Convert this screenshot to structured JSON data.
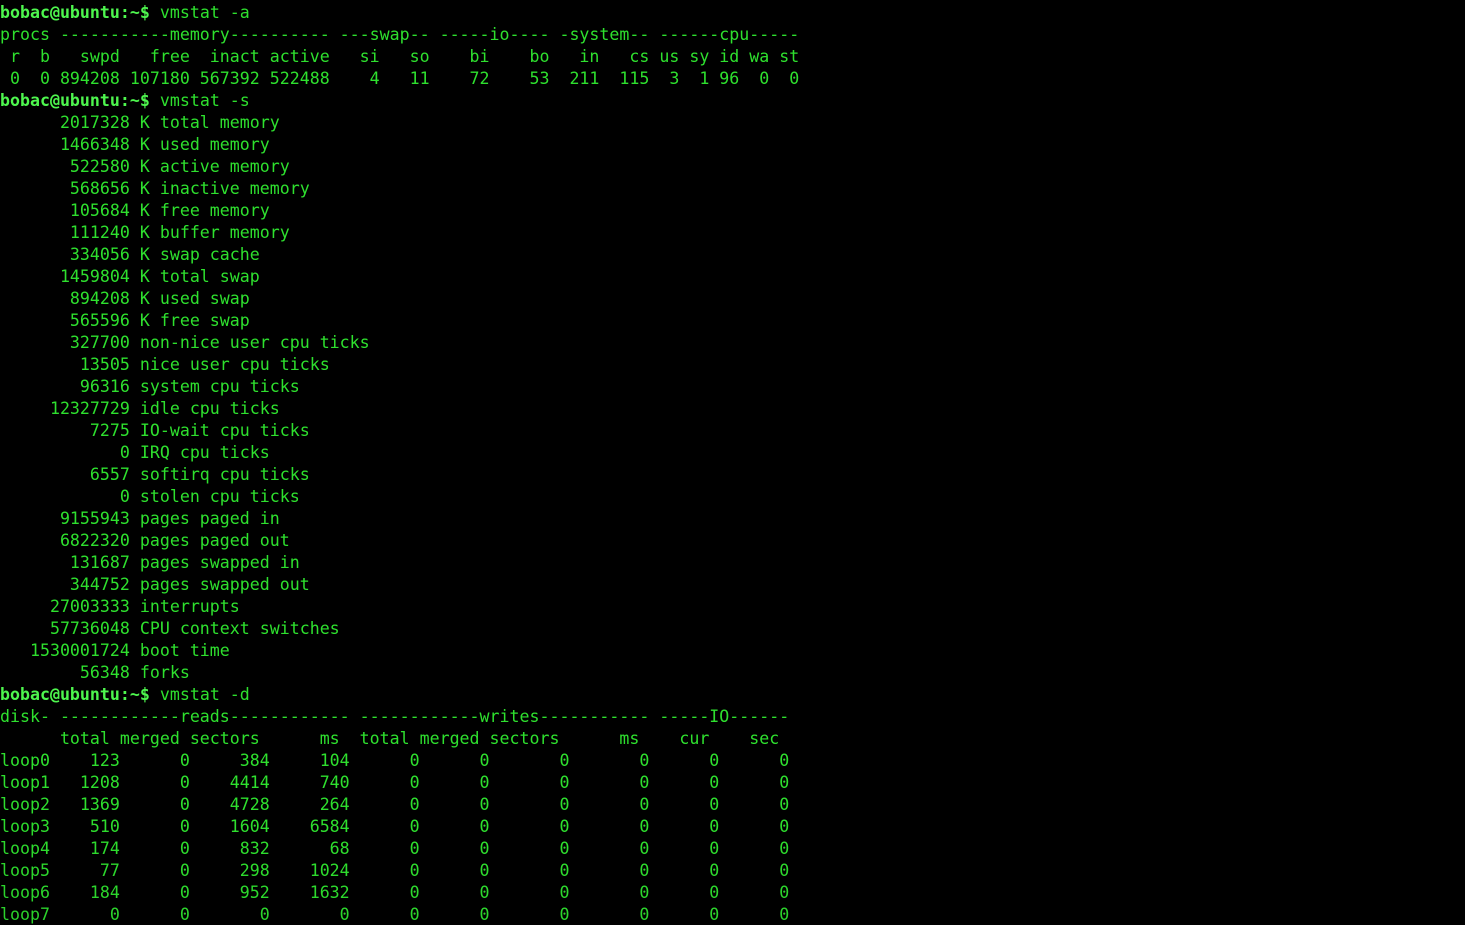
{
  "terminal": {
    "title": "bobac@ubuntu: ~",
    "prompt_user": "bobac@ubuntu",
    "prompt_path": ":~$",
    "colors": {
      "background": "#000000",
      "foreground": "#2ee02e",
      "prompt": "#4ef64e"
    }
  },
  "session": {
    "commands": [
      {
        "prompt_user": "bobac@ubuntu",
        "prompt_path": ":~$",
        "command": " vmstat -a"
      },
      {
        "prompt_user": "bobac@ubuntu",
        "prompt_path": ":~$",
        "command": " vmstat -s"
      },
      {
        "prompt_user": "bobac@ubuntu",
        "prompt_path": ":~$",
        "command": " vmstat -d"
      }
    ]
  },
  "vmstat_a": {
    "group_header": "procs -----------memory---------- ---swap-- -----io---- -system-- ------cpu-----",
    "column_header": " r  b   swpd   free  inact active   si   so    bi    bo   in   cs us sy id wa st",
    "data_row": " 0  0 894208 107180 567392 522488    4   11    72    53  211  115  3  1 96  0  0",
    "columns": [
      "r",
      "b",
      "swpd",
      "free",
      "inact",
      "active",
      "si",
      "so",
      "bi",
      "bo",
      "in",
      "cs",
      "us",
      "sy",
      "id",
      "wa",
      "st"
    ],
    "values": [
      "0",
      "0",
      "894208",
      "107180",
      "567392",
      "522488",
      "4",
      "11",
      "72",
      "53",
      "211",
      "115",
      "3",
      "1",
      "96",
      "0",
      "0"
    ]
  },
  "vmstat_s": {
    "lines": [
      "      2017328 K total memory",
      "      1466348 K used memory",
      "       522580 K active memory",
      "       568656 K inactive memory",
      "       105684 K free memory",
      "       111240 K buffer memory",
      "       334056 K swap cache",
      "      1459804 K total swap",
      "       894208 K used swap",
      "       565596 K free swap",
      "       327700 non-nice user cpu ticks",
      "        13505 nice user cpu ticks",
      "        96316 system cpu ticks",
      "     12327729 idle cpu ticks",
      "         7275 IO-wait cpu ticks",
      "            0 IRQ cpu ticks",
      "         6557 softirq cpu ticks",
      "            0 stolen cpu ticks",
      "      9155943 pages paged in",
      "      6822320 pages paged out",
      "       131687 pages swapped in",
      "       344752 pages swapped out",
      "     27003333 interrupts",
      "     57736048 CPU context switches",
      "   1530001724 boot time",
      "        56348 forks"
    ],
    "stats": [
      {
        "value": "2017328",
        "unit": "K",
        "label": "total memory"
      },
      {
        "value": "1466348",
        "unit": "K",
        "label": "used memory"
      },
      {
        "value": "522580",
        "unit": "K",
        "label": "active memory"
      },
      {
        "value": "568656",
        "unit": "K",
        "label": "inactive memory"
      },
      {
        "value": "105684",
        "unit": "K",
        "label": "free memory"
      },
      {
        "value": "111240",
        "unit": "K",
        "label": "buffer memory"
      },
      {
        "value": "334056",
        "unit": "K",
        "label": "swap cache"
      },
      {
        "value": "1459804",
        "unit": "K",
        "label": "total swap"
      },
      {
        "value": "894208",
        "unit": "K",
        "label": "used swap"
      },
      {
        "value": "565596",
        "unit": "K",
        "label": "free swap"
      },
      {
        "value": "327700",
        "unit": "",
        "label": "non-nice user cpu ticks"
      },
      {
        "value": "13505",
        "unit": "",
        "label": "nice user cpu ticks"
      },
      {
        "value": "96316",
        "unit": "",
        "label": "system cpu ticks"
      },
      {
        "value": "12327729",
        "unit": "",
        "label": "idle cpu ticks"
      },
      {
        "value": "7275",
        "unit": "",
        "label": "IO-wait cpu ticks"
      },
      {
        "value": "0",
        "unit": "",
        "label": "IRQ cpu ticks"
      },
      {
        "value": "6557",
        "unit": "",
        "label": "softirq cpu ticks"
      },
      {
        "value": "0",
        "unit": "",
        "label": "stolen cpu ticks"
      },
      {
        "value": "9155943",
        "unit": "",
        "label": "pages paged in"
      },
      {
        "value": "6822320",
        "unit": "",
        "label": "pages paged out"
      },
      {
        "value": "131687",
        "unit": "",
        "label": "pages swapped in"
      },
      {
        "value": "344752",
        "unit": "",
        "label": "pages swapped out"
      },
      {
        "value": "27003333",
        "unit": "",
        "label": "interrupts"
      },
      {
        "value": "57736048",
        "unit": "",
        "label": "CPU context switches"
      },
      {
        "value": "1530001724",
        "unit": "",
        "label": "boot time"
      },
      {
        "value": "56348",
        "unit": "",
        "label": "forks"
      }
    ]
  },
  "vmstat_d": {
    "group_header": "disk- ------------reads------------ ------------writes----------- -----IO------",
    "column_header": "      total merged sectors      ms  total merged sectors      ms    cur    sec",
    "columns": [
      "disk",
      "reads total",
      "reads merged",
      "reads sectors",
      "reads ms",
      "writes total",
      "writes merged",
      "writes sectors",
      "writes ms",
      "IO cur",
      "IO sec"
    ],
    "rows": [
      "loop0    123      0     384     104      0      0       0       0      0      0",
      "loop1   1208      0    4414     740      0      0       0       0      0      0",
      "loop2   1369      0    4728     264      0      0       0       0      0      0",
      "loop3    510      0    1604    6584      0      0       0       0      0      0",
      "loop4    174      0     832      68      0      0       0       0      0      0",
      "loop5     77      0     298    1024      0      0       0       0      0      0",
      "loop6    184      0     952    1632      0      0       0       0      0      0",
      "loop7      0      0       0       0      0      0       0       0      0      0"
    ],
    "row_data": [
      {
        "disk": "loop0",
        "reads_total": "123",
        "reads_merged": "0",
        "reads_sectors": "384",
        "reads_ms": "104",
        "writes_total": "0",
        "writes_merged": "0",
        "writes_sectors": "0",
        "writes_ms": "0",
        "io_cur": "0",
        "io_sec": "0"
      },
      {
        "disk": "loop1",
        "reads_total": "1208",
        "reads_merged": "0",
        "reads_sectors": "4414",
        "reads_ms": "740",
        "writes_total": "0",
        "writes_merged": "0",
        "writes_sectors": "0",
        "writes_ms": "0",
        "io_cur": "0",
        "io_sec": "0"
      },
      {
        "disk": "loop2",
        "reads_total": "1369",
        "reads_merged": "0",
        "reads_sectors": "4728",
        "reads_ms": "264",
        "writes_total": "0",
        "writes_merged": "0",
        "writes_sectors": "0",
        "writes_ms": "0",
        "io_cur": "0",
        "io_sec": "0"
      },
      {
        "disk": "loop3",
        "reads_total": "510",
        "reads_merged": "0",
        "reads_sectors": "1604",
        "reads_ms": "6584",
        "writes_total": "0",
        "writes_merged": "0",
        "writes_sectors": "0",
        "writes_ms": "0",
        "io_cur": "0",
        "io_sec": "0"
      },
      {
        "disk": "loop4",
        "reads_total": "174",
        "reads_merged": "0",
        "reads_sectors": "832",
        "reads_ms": "68",
        "writes_total": "0",
        "writes_merged": "0",
        "writes_sectors": "0",
        "writes_ms": "0",
        "io_cur": "0",
        "io_sec": "0"
      },
      {
        "disk": "loop5",
        "reads_total": "77",
        "reads_merged": "0",
        "reads_sectors": "298",
        "reads_ms": "1024",
        "writes_total": "0",
        "writes_merged": "0",
        "writes_sectors": "0",
        "writes_ms": "0",
        "io_cur": "0",
        "io_sec": "0"
      },
      {
        "disk": "loop6",
        "reads_total": "184",
        "reads_merged": "0",
        "reads_sectors": "952",
        "reads_ms": "1632",
        "writes_total": "0",
        "writes_merged": "0",
        "writes_sectors": "0",
        "writes_ms": "0",
        "io_cur": "0",
        "io_sec": "0"
      },
      {
        "disk": "loop7",
        "reads_total": "0",
        "reads_merged": "0",
        "reads_sectors": "0",
        "reads_ms": "0",
        "writes_total": "0",
        "writes_merged": "0",
        "writes_sectors": "0",
        "writes_ms": "0",
        "io_cur": "0",
        "io_sec": "0"
      }
    ]
  }
}
